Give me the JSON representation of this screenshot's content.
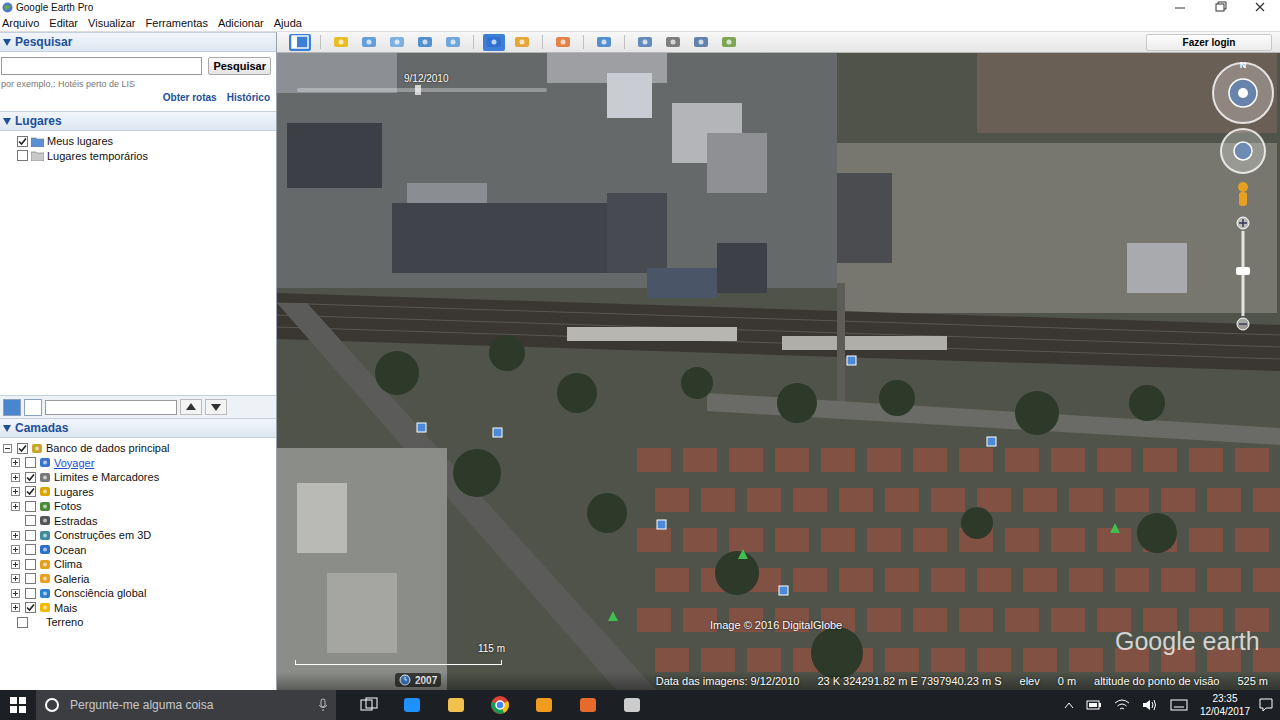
{
  "window": {
    "title": "Google Earth Pro"
  },
  "menu": [
    "Arquivo",
    "Editar",
    "Visualizar",
    "Ferramentas",
    "Adicionar",
    "Ajuda"
  ],
  "search_panel": {
    "title": "Pesquisar",
    "expanded": true,
    "button": "Pesquisar",
    "hint": "por exemplo,: Hotéis perto de LIS",
    "links": [
      "Obter rotas",
      "Histórico"
    ]
  },
  "places_panel": {
    "title": "Lugares",
    "expanded": true,
    "items": [
      {
        "label": "Meus lugares",
        "checked": true
      },
      {
        "label": "Lugares temporários",
        "checked": false
      }
    ]
  },
  "layers_panel": {
    "title": "Camadas",
    "expanded": true,
    "items": [
      {
        "label": "Banco de dados principal",
        "checked": true,
        "depth": 0,
        "expandable": true,
        "expanded": true,
        "link": false
      },
      {
        "label": "Voyager",
        "checked": false,
        "depth": 1,
        "expandable": true,
        "expanded": false,
        "link": true
      },
      {
        "label": "Limites e Marcadores",
        "checked": true,
        "depth": 1,
        "expandable": true,
        "expanded": false,
        "link": false
      },
      {
        "label": "Lugares",
        "checked": true,
        "depth": 1,
        "expandable": true,
        "expanded": false,
        "link": false
      },
      {
        "label": "Fotos",
        "checked": false,
        "depth": 1,
        "expandable": true,
        "expanded": false,
        "link": false
      },
      {
        "label": "Estradas",
        "checked": false,
        "depth": 1,
        "expandable": false,
        "expanded": false,
        "link": false
      },
      {
        "label": "Construções em 3D",
        "checked": false,
        "depth": 1,
        "expandable": true,
        "expanded": false,
        "link": false
      },
      {
        "label": "Ocean",
        "checked": false,
        "depth": 1,
        "expandable": true,
        "expanded": false,
        "link": false
      },
      {
        "label": "Clima",
        "checked": false,
        "depth": 1,
        "expandable": true,
        "expanded": false,
        "link": false
      },
      {
        "label": "Galeria",
        "checked": false,
        "depth": 1,
        "expandable": true,
        "expanded": false,
        "link": false
      },
      {
        "label": "Consciência global",
        "checked": false,
        "depth": 1,
        "expandable": true,
        "expanded": false,
        "link": false
      },
      {
        "label": "Mais",
        "checked": true,
        "depth": 1,
        "expandable": true,
        "expanded": false,
        "link": false
      },
      {
        "label": "Terreno",
        "checked": false,
        "depth": 0,
        "expandable": false,
        "expanded": false,
        "link": false
      }
    ]
  },
  "toolbar": {
    "tool_buttons": [
      {
        "selected": true
      },
      {
        "selected": false
      },
      {
        "selected": false
      },
      {
        "selected": false
      },
      {
        "selected": false
      },
      {
        "selected": false
      },
      {
        "selected": true
      },
      {
        "selected": false
      },
      {
        "selected": false
      },
      {
        "selected": false
      },
      {
        "selected": false
      },
      {
        "selected": false
      },
      {
        "selected": false
      },
      {
        "selected": false
      }
    ],
    "login_button": "Fazer login"
  },
  "map": {
    "date_overlay": "9/12/2010",
    "north": "N",
    "copyright": "Image © 2016 DigitalGlobe",
    "logo": "Google earth",
    "scale": "115 m",
    "timeline_year": "2007"
  },
  "status_bar": {
    "image_date": "Data das imagens: 9/12/2010",
    "coords": "23 K 324291.82 m E 7397940.23 m S",
    "elev_label": "elev",
    "elev": "0 m",
    "eye_alt_label": "altitude do ponto de visão",
    "eye_alt": "525 m"
  },
  "taskbar": {
    "search_placeholder": "Pergunte-me alguma coisa",
    "time": "23:35",
    "date": "12/04/2017"
  }
}
